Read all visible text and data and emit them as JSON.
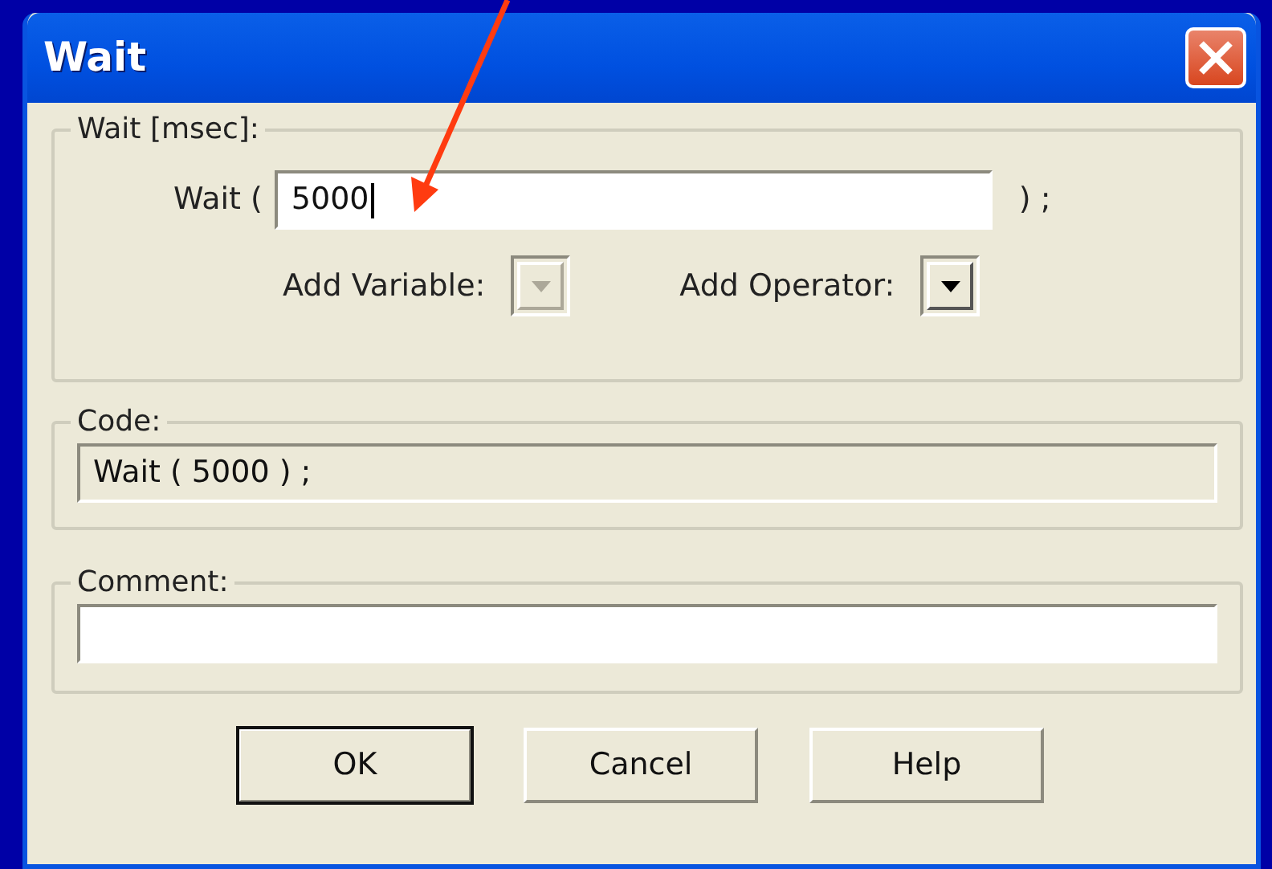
{
  "window": {
    "title": "Wait"
  },
  "wait_group": {
    "legend": "Wait [msec]:",
    "prefix": "Wait (",
    "value": "5000",
    "suffix": ") ;",
    "focused": true,
    "pickers": [
      {
        "label": "Add Variable:",
        "disabled": true
      },
      {
        "label": "Add Operator:",
        "disabled": false
      }
    ]
  },
  "code_group": {
    "legend": "Code:",
    "value": "Wait ( 5000 ) ;",
    "readonly": true
  },
  "comment_group": {
    "legend": "Comment:"
  },
  "buttons": [
    {
      "label": "OK",
      "default": true
    },
    {
      "label": "Cancel",
      "default": false
    },
    {
      "label": "Help",
      "default": false
    }
  ]
}
